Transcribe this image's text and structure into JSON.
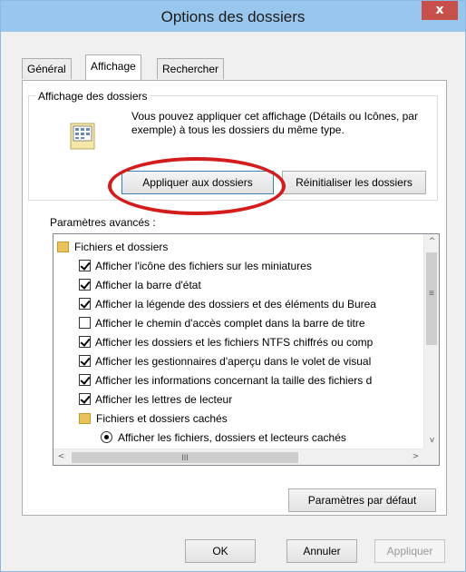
{
  "window": {
    "title": "Options des dossiers",
    "close_glyph": "x"
  },
  "tabs": [
    {
      "label": "Général",
      "active": false
    },
    {
      "label": "Affichage",
      "active": true
    },
    {
      "label": "Rechercher",
      "active": false
    }
  ],
  "folder_view": {
    "group_title": "Affichage des dossiers",
    "description": "Vous pouvez appliquer cet affichage (Détails ou Icônes, par exemple) à tous les dossiers du même type.",
    "apply_button": "Appliquer aux dossiers",
    "reset_button": "Réinitialiser les dossiers",
    "icon": "folder-view-icon"
  },
  "advanced": {
    "label": "Paramètres avancés :",
    "items": [
      {
        "type": "folder",
        "label": "Fichiers et dossiers",
        "indent": 0
      },
      {
        "type": "checkbox",
        "checked": true,
        "label": "Afficher l'icône des fichiers sur les miniatures",
        "indent": 1
      },
      {
        "type": "checkbox",
        "checked": true,
        "label": "Afficher la barre d'état",
        "indent": 1
      },
      {
        "type": "checkbox",
        "checked": true,
        "label": "Afficher la légende des dossiers et des éléments du Burea",
        "indent": 1
      },
      {
        "type": "checkbox",
        "checked": false,
        "label": "Afficher le chemin d'accès complet dans la barre de titre",
        "indent": 1
      },
      {
        "type": "checkbox",
        "checked": true,
        "label": "Afficher les dossiers et les fichiers NTFS chiffrés ou comp",
        "indent": 1
      },
      {
        "type": "checkbox",
        "checked": true,
        "label": "Afficher les gestionnaires d'aperçu dans le volet de visual",
        "indent": 1
      },
      {
        "type": "checkbox",
        "checked": true,
        "label": "Afficher les informations concernant la taille des fichiers d",
        "indent": 1
      },
      {
        "type": "checkbox",
        "checked": true,
        "label": "Afficher les lettres de lecteur",
        "indent": 1
      },
      {
        "type": "folder",
        "label": "Fichiers et dossiers cachés",
        "indent": 1
      },
      {
        "type": "radio",
        "selected": true,
        "label": "Afficher les fichiers, dossiers et lecteurs cachés",
        "indent": 2
      }
    ],
    "scroll_up": "^",
    "scroll_down": "v",
    "scroll_left": "<",
    "scroll_right": ">",
    "h_thumb_grip": "III",
    "v_thumb_grip": "≡"
  },
  "defaults_button": "Paramètres par défaut",
  "footer": {
    "ok": "OK",
    "cancel": "Annuler",
    "apply": "Appliquer"
  },
  "colors": {
    "titlebar": "#99c6ec",
    "close": "#c7504b",
    "highlight": "#d41c1c"
  }
}
